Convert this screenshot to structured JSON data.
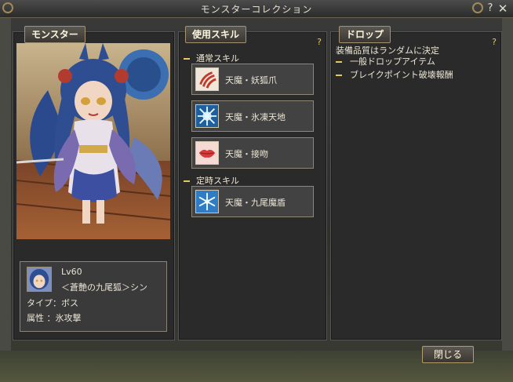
{
  "window": {
    "title": "モンスターコレクション",
    "help_glyph": "?",
    "close_glyph": "✕"
  },
  "monster_panel": {
    "tab_label": "モンスター",
    "level": "Lv60",
    "name": "＜蒼艶の九尾狐＞シン",
    "type": "タイプ：ボス",
    "attribute": "属性 ：氷攻撃"
  },
  "skills_panel": {
    "tab_label": "使用スキル",
    "help_glyph": "?",
    "sections": [
      {
        "header": "通常スキル",
        "skills": [
          {
            "name": "天魔・妖狐爪",
            "icon": "claw-icon"
          },
          {
            "name": "天魔・氷凍天地",
            "icon": "ice-burst-icon"
          },
          {
            "name": "天魔・接吻",
            "icon": "lips-icon"
          }
        ]
      },
      {
        "header": "定時スキル",
        "skills": [
          {
            "name": "天魔・九尾魔盾",
            "icon": "snowflake-icon"
          }
        ]
      }
    ]
  },
  "drop_panel": {
    "tab_label": "ドロップ",
    "help_glyph": "?",
    "note": "装備品質はランダムに決定",
    "items": [
      "一般ドロップアイテム",
      "ブレイクポイント破壊報酬"
    ]
  },
  "footer": {
    "close_label": "閉じる"
  },
  "colors": {
    "accent": "#e7c95a",
    "border": "#a59272",
    "panel_bg": "#2a2a2a"
  }
}
